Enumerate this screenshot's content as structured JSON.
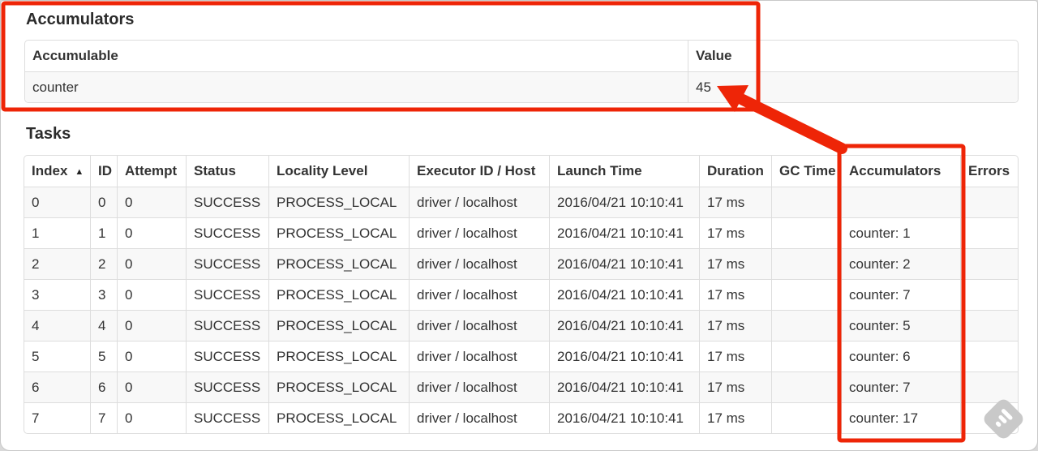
{
  "annotation": {
    "color": "#ee2507",
    "highlighted_value": "45"
  },
  "accumulators_section": {
    "title": "Accumulators",
    "table": {
      "headers": [
        "Accumulable",
        "Value"
      ],
      "rows": [
        [
          "counter",
          "45"
        ]
      ]
    }
  },
  "tasks_section": {
    "title": "Tasks",
    "table": {
      "sort_icon": "▲",
      "sorted_column": "Index",
      "headers": [
        "Index",
        "ID",
        "Attempt",
        "Status",
        "Locality Level",
        "Executor ID / Host",
        "Launch Time",
        "Duration",
        "GC Time",
        "Accumulators",
        "Errors"
      ],
      "rows": [
        [
          "0",
          "0",
          "0",
          "SUCCESS",
          "PROCESS_LOCAL",
          "driver / localhost",
          "2016/04/21 10:10:41",
          "17 ms",
          "",
          "",
          ""
        ],
        [
          "1",
          "1",
          "0",
          "SUCCESS",
          "PROCESS_LOCAL",
          "driver / localhost",
          "2016/04/21 10:10:41",
          "17 ms",
          "",
          "counter: 1",
          ""
        ],
        [
          "2",
          "2",
          "0",
          "SUCCESS",
          "PROCESS_LOCAL",
          "driver / localhost",
          "2016/04/21 10:10:41",
          "17 ms",
          "",
          "counter: 2",
          ""
        ],
        [
          "3",
          "3",
          "0",
          "SUCCESS",
          "PROCESS_LOCAL",
          "driver / localhost",
          "2016/04/21 10:10:41",
          "17 ms",
          "",
          "counter: 7",
          ""
        ],
        [
          "4",
          "4",
          "0",
          "SUCCESS",
          "PROCESS_LOCAL",
          "driver / localhost",
          "2016/04/21 10:10:41",
          "17 ms",
          "",
          "counter: 5",
          ""
        ],
        [
          "5",
          "5",
          "0",
          "SUCCESS",
          "PROCESS_LOCAL",
          "driver / localhost",
          "2016/04/21 10:10:41",
          "17 ms",
          "",
          "counter: 6",
          ""
        ],
        [
          "6",
          "6",
          "0",
          "SUCCESS",
          "PROCESS_LOCAL",
          "driver / localhost",
          "2016/04/21 10:10:41",
          "17 ms",
          "",
          "counter: 7",
          ""
        ],
        [
          "7",
          "7",
          "0",
          "SUCCESS",
          "PROCESS_LOCAL",
          "driver / localhost",
          "2016/04/21 10:10:41",
          "17 ms",
          "",
          "counter: 17",
          ""
        ]
      ]
    }
  }
}
